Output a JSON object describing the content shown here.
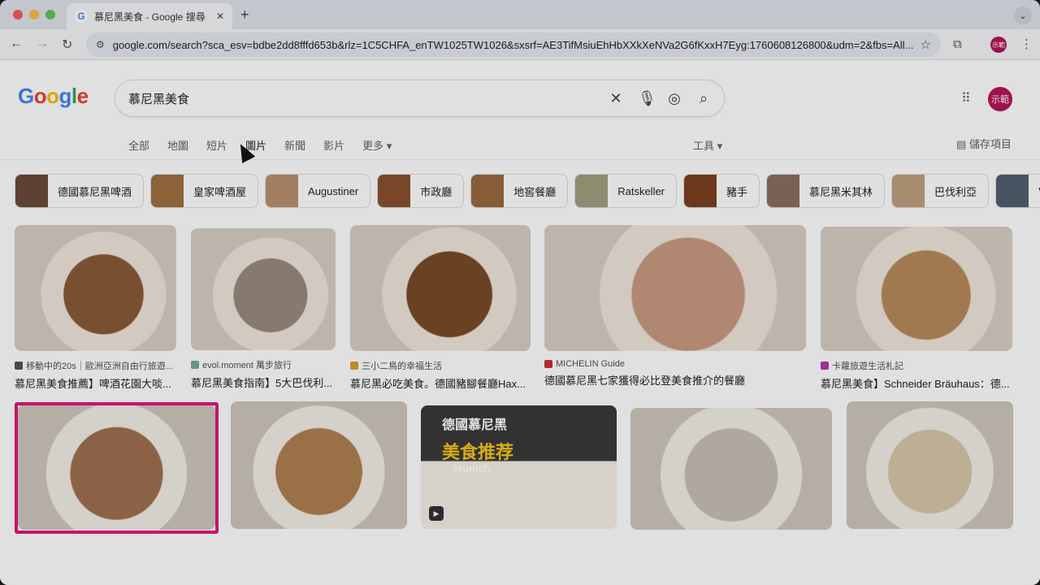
{
  "browser": {
    "tab_title": "慕尼黑美食 - Google 搜尋",
    "url": "google.com/search?sca_esv=bdbe2dd8fffd653b&rlz=1C5CHFA_enTW1025TW1026&sxsrf=AE3TifMsiuEhHbXXkXeNVa2G6fKxxH7Eyg:1760608126800&udm=2&fbs=All...",
    "profile_label": "示範"
  },
  "search": {
    "logo": [
      "G",
      "o",
      "o",
      "g",
      "l",
      "e"
    ],
    "query": "慕尼黑美食",
    "profile_label": "示範"
  },
  "nav": {
    "tabs": [
      "全部",
      "地圖",
      "短片",
      "圖片",
      "新聞",
      "影片",
      "更多 ▾"
    ],
    "tools": "工具 ▾",
    "saved": "儲存項目"
  },
  "chips": [
    "德國慕尼黑啤酒",
    "皇家啤酒屋",
    "Augustiner",
    "市政廳",
    "地窖餐廳",
    "Ratskeller",
    "豬手",
    "慕尼黑米其林",
    "巴伐利亞",
    "Vinze"
  ],
  "results": [
    {
      "source": "移動中的20s｜歐洲亞洲自由行旅遊...",
      "title": "慕尼黑美食推薦】啤酒花園大啖...",
      "color": "#8a5a3a"
    },
    {
      "source": "evol.moment 萬步旅行",
      "title": "慕尼黑美食指南】5大巴伐利...",
      "color": "#9a8a80"
    },
    {
      "source": "三小二鳥的幸福生活",
      "title": "慕尼黑必吃美食。德國豬腳餐廳Hax...",
      "color": "#7a4a2a"
    },
    {
      "source": "MICHELIN Guide",
      "title": "德國慕尼黑七家獲得必比登美食推介的餐廳",
      "color": "#c99a80"
    },
    {
      "source": "卡蘿旅遊生活札記",
      "title": "慕尼黑美食】Schneider Bräuhaus：德...",
      "color": "#b88a5a"
    }
  ],
  "row2": [
    {
      "color": "#a07050"
    },
    {
      "color": "#b08050"
    },
    {
      "color": "#8a3030",
      "overlay_text": "德國慕尼黑",
      "overlay_text2": "美食推荐",
      "overlay_text3": "Munich"
    },
    {
      "color": "#c8c0b8"
    },
    {
      "color": "#d8c8a8"
    }
  ]
}
